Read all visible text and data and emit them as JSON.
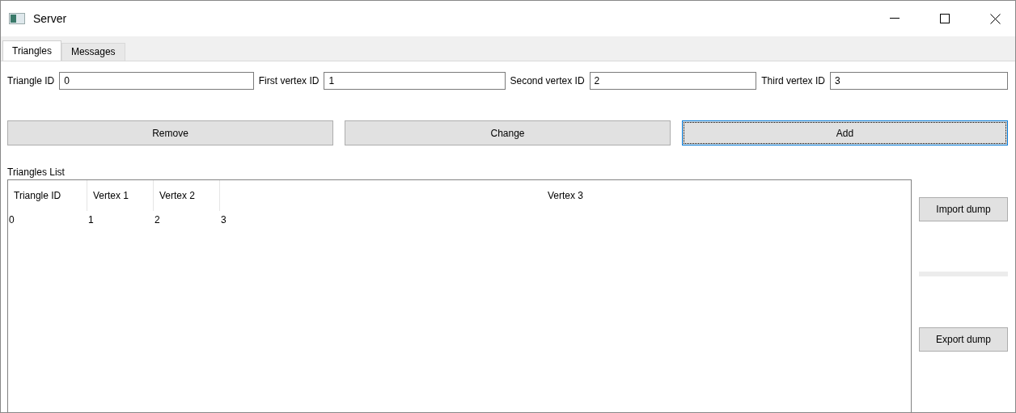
{
  "window": {
    "title": "Server"
  },
  "tabs": [
    {
      "label": "Triangles",
      "selected": true
    },
    {
      "label": "Messages",
      "selected": false
    }
  ],
  "fields": [
    {
      "label": "Triangle ID",
      "value": "0"
    },
    {
      "label": "First vertex ID",
      "value": "1"
    },
    {
      "label": "Second vertex ID",
      "value": "2"
    },
    {
      "label": "Third vertex ID",
      "value": "3"
    }
  ],
  "buttons": [
    {
      "label": "Remove",
      "focused": false
    },
    {
      "label": "Change",
      "focused": false
    },
    {
      "label": "Add",
      "focused": true
    }
  ],
  "table": {
    "title": "Triangles List",
    "columns": [
      "Triangle ID",
      "Vertex 1",
      "Vertex 2",
      "Vertex 3"
    ],
    "rows": [
      [
        "0",
        "1",
        "2",
        "3"
      ]
    ]
  },
  "side_buttons": [
    "Import dump",
    "Export dump"
  ]
}
